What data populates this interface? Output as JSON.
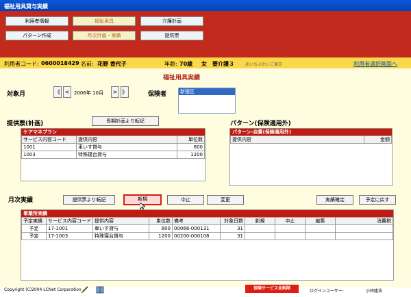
{
  "window": {
    "title": "福祉用具貸与実績"
  },
  "nav": {
    "row1": [
      "利用者情報",
      "福祉用具",
      "介護計画"
    ],
    "row2": [
      "パターン作成",
      "月次計画・実績",
      "提供票"
    ]
  },
  "user": {
    "code_label": "利用者コード:",
    "code": "0600018429",
    "name_label": "名前:",
    "name": "花野 香代子",
    "age_label": "年齢:",
    "age": "70歳",
    "sex": "女",
    "care_level": "要介護３",
    "office": "あいちぶかいご東京",
    "select_link": "利用者選択画面へ"
  },
  "main": {
    "section_title": "福祉用具実績",
    "target_month_label": "対象月",
    "month_nav": {
      "first": "《",
      "prev": "<",
      "value": "2006年 10月",
      "next": ">",
      "last": "》"
    },
    "insurer_label": "保険者",
    "insurer_selected": "新宿区"
  },
  "plan": {
    "label": "提供票(計画)",
    "transfer_btn": "長期計画より転記",
    "panel_title": "ケアマネプラン",
    "headers": [
      "サービス内容コード",
      "提供内容",
      "単位数"
    ],
    "rows": [
      {
        "code": "1001",
        "content": "車いす貸与",
        "units": "800"
      },
      {
        "code": "1003",
        "content": "特殊寝台貸与",
        "units": "1200"
      }
    ]
  },
  "pattern": {
    "label": "パターン(保険適用外)",
    "panel_title": "パターン-自費(保険適用外)",
    "headers": [
      "提供内容",
      "金額"
    ]
  },
  "monthly": {
    "label": "月次実績",
    "buttons": {
      "transfer": "提供票より転記",
      "new": "新規",
      "cancel": "中止",
      "change": "変更",
      "confirm": "実績確定",
      "back": "予定に戻す"
    },
    "panel_title": "事業所実績",
    "headers": [
      "予定実績",
      "サービス内容コード",
      "提供内容",
      "単位数",
      "備考",
      "対象日数",
      "新規",
      "中止",
      "編集",
      "消費税"
    ],
    "rows": [
      {
        "kind": "予定",
        "code": "17-1001",
        "content": "車いす貸与",
        "units": "800",
        "note": "00066-000131",
        "days": "31"
      },
      {
        "kind": "予定",
        "code": "17-1003",
        "content": "特殊寝台貸与",
        "units": "1200",
        "note": "00200-000108",
        "days": "31"
      }
    ]
  },
  "footer": {
    "copyright": "Copyright (C)2004 LCNet Corporation",
    "delete_btn": "保険サービス全削除",
    "login_label": "ログインユーザー:",
    "login_user": "小林隆浩"
  }
}
